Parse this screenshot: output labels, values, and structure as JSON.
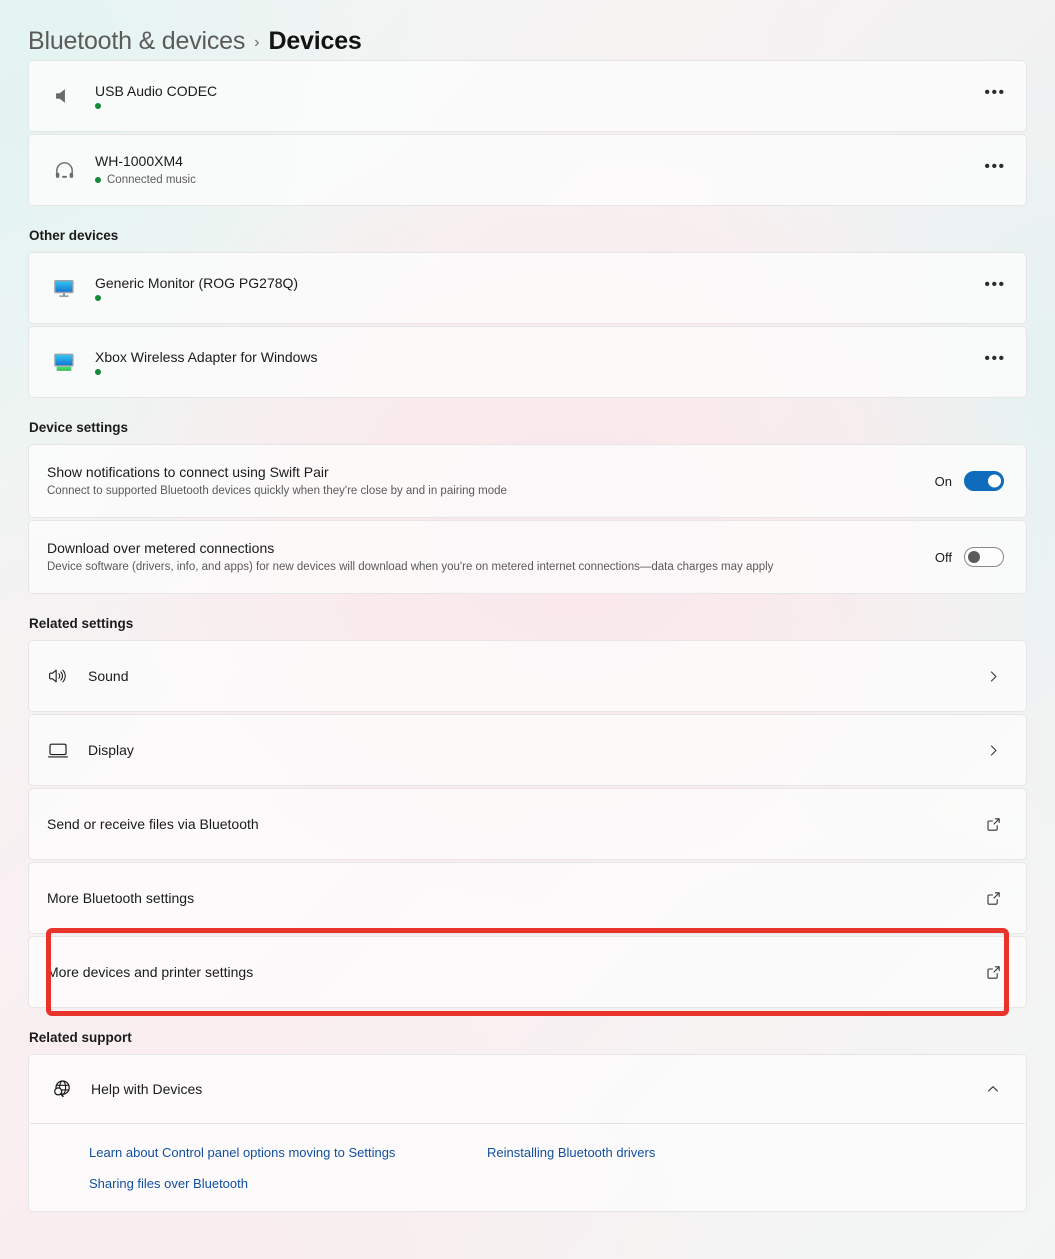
{
  "breadcrumb": {
    "parent": "Bluetooth & devices",
    "separator": "›",
    "current": "Devices"
  },
  "connected_devices": [
    {
      "name": "USB Audio CODEC",
      "status": "",
      "icon": "speaker-icon",
      "menu": "•••"
    },
    {
      "name": "WH-1000XM4",
      "status": "Connected music",
      "icon": "headphones-icon",
      "menu": "•••"
    }
  ],
  "other_devices": {
    "title": "Other devices",
    "items": [
      {
        "name": "Generic Monitor (ROG PG278Q)",
        "status": "",
        "icon": "monitor-icon",
        "menu": "•••"
      },
      {
        "name": "Xbox Wireless Adapter for Windows",
        "status": "",
        "icon": "monitor-green-icon",
        "menu": "•••"
      }
    ]
  },
  "device_settings": {
    "title": "Device settings",
    "items": [
      {
        "title": "Show notifications to connect using Swift Pair",
        "description": "Connect to supported Bluetooth devices quickly when they're close by and in pairing mode",
        "state_label": "On",
        "state": "on"
      },
      {
        "title": "Download over metered connections",
        "description": "Device software (drivers, info, and apps) for new devices will download when you're on metered internet connections—data charges may apply",
        "state_label": "Off",
        "state": "off"
      }
    ]
  },
  "related_settings": {
    "title": "Related settings",
    "items": [
      {
        "label": "Sound",
        "icon": "sound-icon",
        "affordance": "chevron-right-icon",
        "highlighted": false
      },
      {
        "label": "Display",
        "icon": "display-icon",
        "affordance": "chevron-right-icon",
        "highlighted": false
      },
      {
        "label": "Send or receive files via Bluetooth",
        "icon": "",
        "affordance": "external-link-icon",
        "highlighted": false
      },
      {
        "label": "More Bluetooth settings",
        "icon": "",
        "affordance": "external-link-icon",
        "highlighted": false
      },
      {
        "label": "More devices and printer settings",
        "icon": "",
        "affordance": "external-link-icon",
        "highlighted": true
      }
    ]
  },
  "related_support": {
    "title": "Related support",
    "header_label": "Help with Devices",
    "header_icon": "globe-help-icon",
    "expand_state": "chevron-up-icon",
    "links": [
      "Learn about Control panel options moving to Settings",
      "Reinstalling Bluetooth drivers",
      "Sharing files over Bluetooth"
    ]
  },
  "colors": {
    "accent_blue": "#0f6cbd",
    "link_blue": "#12509e",
    "status_green": "#138a36",
    "highlight_red": "#e8342a",
    "text_primary": "#1b1b1b",
    "text_secondary": "#5a5a5a"
  }
}
